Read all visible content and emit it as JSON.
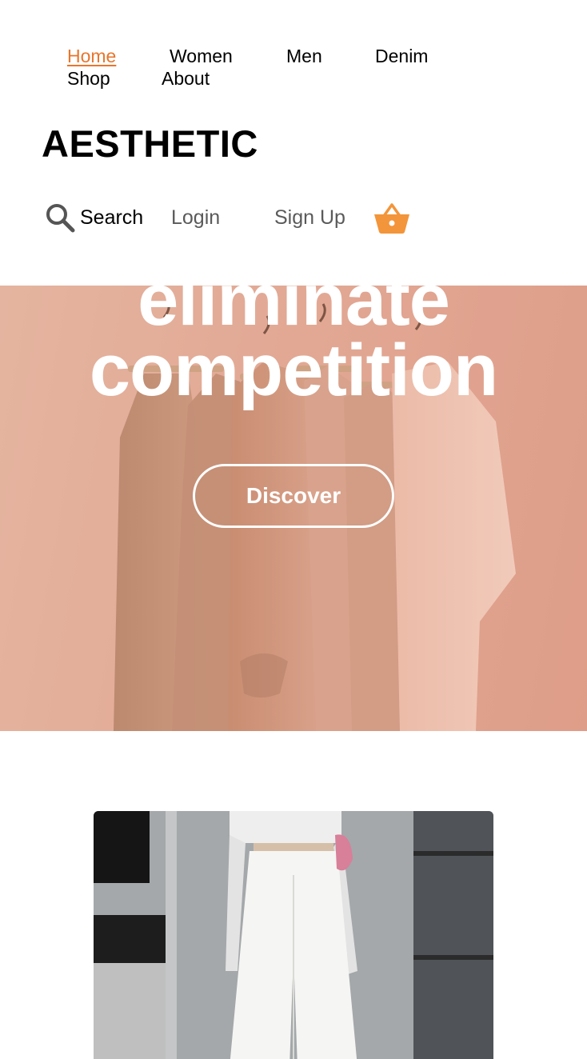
{
  "nav": {
    "items": [
      {
        "label": "Home",
        "active": true
      },
      {
        "label": "Women",
        "active": false
      },
      {
        "label": "Men",
        "active": false
      },
      {
        "label": "Denim",
        "active": false
      },
      {
        "label": "Shop",
        "active": false
      },
      {
        "label": "About",
        "active": false
      }
    ],
    "active_color": "#e8762c"
  },
  "logo": {
    "text": "AESTHETIC"
  },
  "actions": {
    "search_label": "Search",
    "search_icon": "search-icon",
    "login_label": "Login",
    "signup_label": "Sign Up",
    "cart_icon": "basket-icon",
    "cart_color": "#f3953a"
  },
  "hero": {
    "line_1": "eliminate",
    "line_2": "competition",
    "cta_label": "Discover",
    "tint_color": "#e2a995"
  },
  "product": {
    "image_alt": "white-trousers-photo"
  }
}
